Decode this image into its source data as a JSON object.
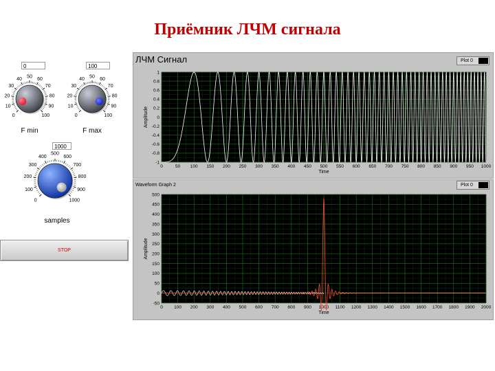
{
  "page": {
    "title": "Приёмник ЛЧМ сигнала"
  },
  "fmin": {
    "label": "F min",
    "value": "0",
    "ticks": [
      "0",
      "10",
      "20",
      "30",
      "40",
      "50",
      "60",
      "70",
      "80",
      "90",
      "100"
    ],
    "knob_value": 0.1,
    "accent": "#e8112d"
  },
  "fmax": {
    "label": "F max",
    "value": "100",
    "ticks": [
      "0",
      "10",
      "20",
      "30",
      "40",
      "50",
      "60",
      "70",
      "80",
      "90",
      "100"
    ],
    "knob_value": 0.9,
    "accent": "#1424c8"
  },
  "samples": {
    "label": "samples",
    "value": "1000",
    "ticks": [
      "0",
      "100",
      "200",
      "300",
      "400",
      "500",
      "600",
      "700",
      "800",
      "900",
      "1000"
    ],
    "knob_value": 1.0,
    "accent": "#1f56e0"
  },
  "stop": {
    "label": "STOP"
  },
  "graph1": {
    "title": "ЛЧМ Сигнал",
    "legend": "Plot 0",
    "xlabel": "Time",
    "ylabel": "Amplitude",
    "xticks": [
      "0",
      "50",
      "100",
      "150",
      "200",
      "250",
      "300",
      "350",
      "400",
      "450",
      "500",
      "550",
      "600",
      "650",
      "700",
      "750",
      "800",
      "850",
      "900",
      "950",
      "1000"
    ],
    "yticks": [
      "1",
      "0.8",
      "0.6",
      "0.4",
      "0.2",
      "0",
      "-0.2",
      "-0.4",
      "-0.6",
      "-0.8",
      "-1"
    ]
  },
  "graph2": {
    "title": "Waveform Graph 2",
    "legend": "Plot 0",
    "xlabel": "Time",
    "ylabel": "Amplitude",
    "xticks": [
      "0",
      "100",
      "200",
      "300",
      "400",
      "500",
      "600",
      "700",
      "800",
      "900",
      "1000",
      "1100",
      "1200",
      "1300",
      "1400",
      "1500",
      "1600",
      "1700",
      "1800",
      "1900",
      "2000"
    ],
    "yticks": [
      "500",
      "450",
      "400",
      "350",
      "300",
      "250",
      "200",
      "150",
      "100",
      "50",
      "0",
      "-50"
    ]
  },
  "chart_data": [
    {
      "type": "line",
      "title": "ЛЧМ Сигнал",
      "xlabel": "Time",
      "ylabel": "Amplitude",
      "xlim": [
        0,
        1000
      ],
      "ylim": [
        -1,
        1
      ],
      "grid": true,
      "series": [
        {
          "name": "Plot 0",
          "function": "cos chirp",
          "f_start": 0,
          "f_end": 100,
          "n": 1000
        }
      ]
    },
    {
      "type": "line",
      "title": "Waveform Graph 2",
      "xlabel": "Time",
      "ylabel": "Amplitude",
      "xlim": [
        0,
        2000
      ],
      "ylim": [
        -50,
        500
      ],
      "grid": true,
      "series": [
        {
          "name": "Plot 0",
          "peak_x": 1000,
          "peak_y": 480
        }
      ]
    }
  ],
  "colors": {
    "plot_bg": "#000000",
    "grid": "#1c6b1c",
    "trace1": "#ffffff",
    "trace2": "#ff4a2e"
  }
}
